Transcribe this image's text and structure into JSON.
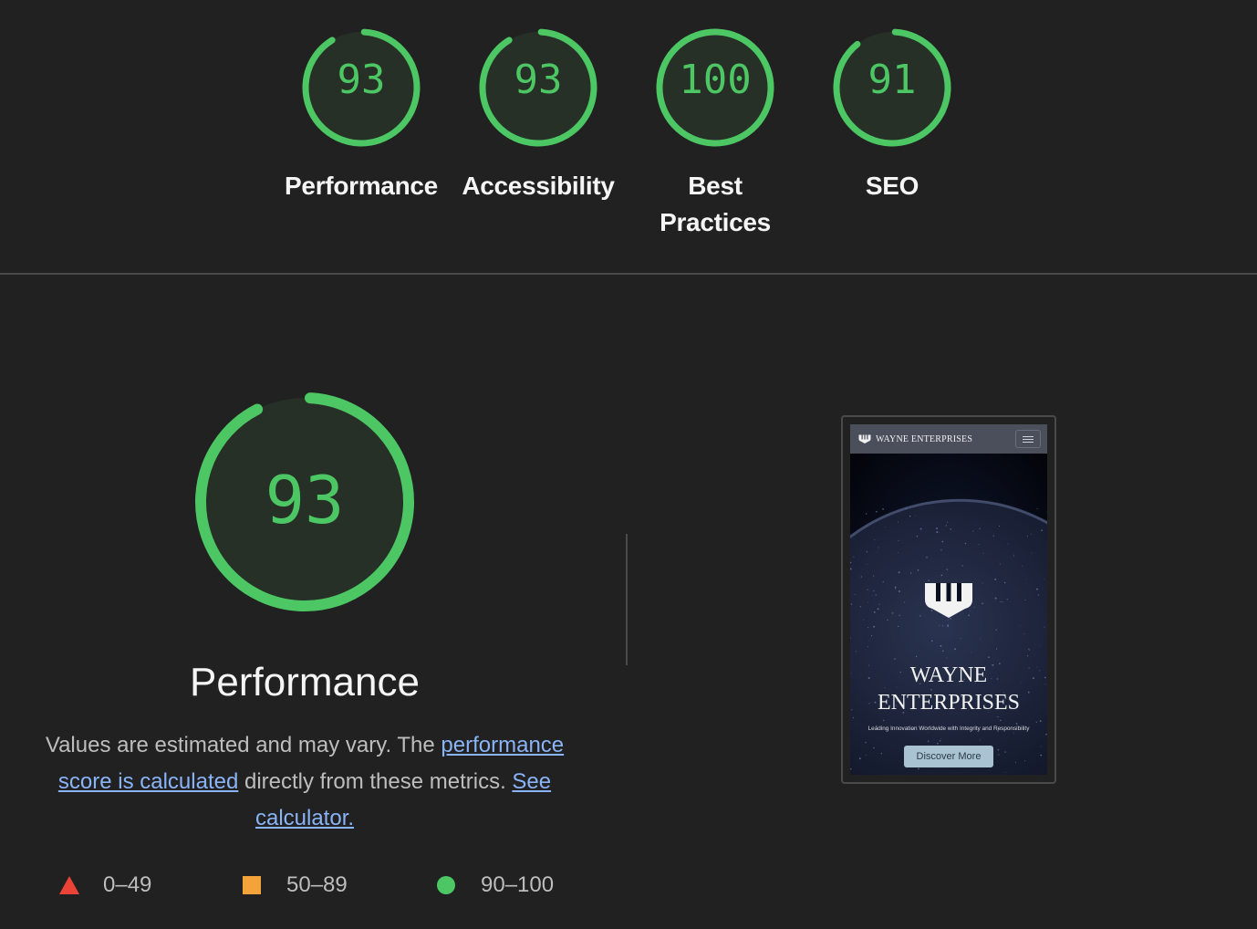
{
  "gauges": [
    {
      "score": 93,
      "label": "Performance",
      "color": "#4cc764"
    },
    {
      "score": 93,
      "label": "Accessibility",
      "color": "#4cc764"
    },
    {
      "score": 100,
      "label": "Best Practices",
      "color": "#4cc764"
    },
    {
      "score": 91,
      "label": "SEO",
      "color": "#4cc764"
    }
  ],
  "performance": {
    "score": 93,
    "title": "Performance",
    "desc_text1": "Values are estimated and may vary. The ",
    "desc_link1": "performance score is calculated",
    "desc_text2": " directly from these metrics. ",
    "desc_link2": "See calculator."
  },
  "legend": [
    {
      "range": "0–49",
      "shape": "triangle",
      "color": "#eb4436"
    },
    {
      "range": "50–89",
      "shape": "square",
      "color": "#f4a33a"
    },
    {
      "range": "90–100",
      "shape": "circle",
      "color": "#4cc764"
    }
  ],
  "screenshot": {
    "nav_brand": "WAYNE ENTERPRISES",
    "hero_title_line1": "WAYNE",
    "hero_title_line2": "ENTERPRISES",
    "tagline": "Leading Innovation Worldwide with Integrity and Responsibility",
    "button": "Discover More",
    "menu_icon": "hamburger-icon",
    "logo_icon": "wayne-logo-icon"
  },
  "colors": {
    "pass": "#4cc764",
    "average": "#f4a33a",
    "fail": "#eb4436",
    "link": "#8ab4f8",
    "background": "#212121"
  }
}
